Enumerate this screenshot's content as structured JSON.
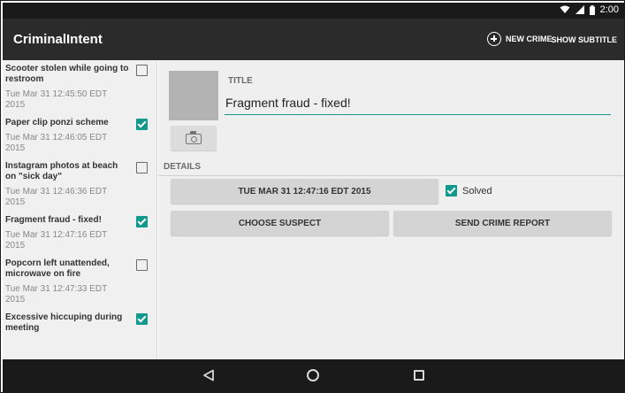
{
  "status_bar": {
    "time": "2:00",
    "icons": [
      "wifi-icon",
      "signal-icon",
      "battery-icon"
    ]
  },
  "action_bar": {
    "title": "CriminalIntent",
    "new_crime_label": "NEW CRIME",
    "new_crime_icon": "add-circle-icon",
    "show_subtitle_label": "SHOW SUBTITLE"
  },
  "crime_list": {
    "items": [
      {
        "title": "Scooter stolen while going to restroom",
        "date": "Tue Mar 31 12:45:50 EDT 2015",
        "solved": false
      },
      {
        "title": "Paper clip ponzi scheme",
        "date": "Tue Mar 31 12:46:05 EDT 2015",
        "solved": true
      },
      {
        "title": "Instagram photos at beach on \"sick day\"",
        "date": "Tue Mar 31 12:46:36 EDT 2015",
        "solved": false
      },
      {
        "title": "Fragment fraud - fixed!",
        "date": "Tue Mar 31 12:47:16 EDT 2015",
        "solved": true
      },
      {
        "title": "Popcorn left unattended, microwave on fire",
        "date": "Tue Mar 31 12:47:33 EDT 2015",
        "solved": false
      },
      {
        "title": "Excessive hiccuping during meeting",
        "date": "",
        "solved": true
      }
    ]
  },
  "detail": {
    "title_label": "TITLE",
    "title_value": "Fragment fraud - fixed!",
    "camera_icon": "camera-icon",
    "details_label": "DETAILS",
    "date_button_label": "TUE MAR 31 12:47:16 EDT 2015",
    "solved_label": "Solved",
    "solved": true,
    "choose_suspect_label": "CHOOSE SUSPECT",
    "send_report_label": "SEND CRIME REPORT"
  },
  "nav_bar": {
    "icons": [
      "back-icon",
      "home-icon",
      "recents-icon"
    ]
  },
  "colors": {
    "accent": "#11998e",
    "action_bar": "#2b2b2b",
    "status_bar": "#1a1a1a",
    "background": "#efefef"
  }
}
